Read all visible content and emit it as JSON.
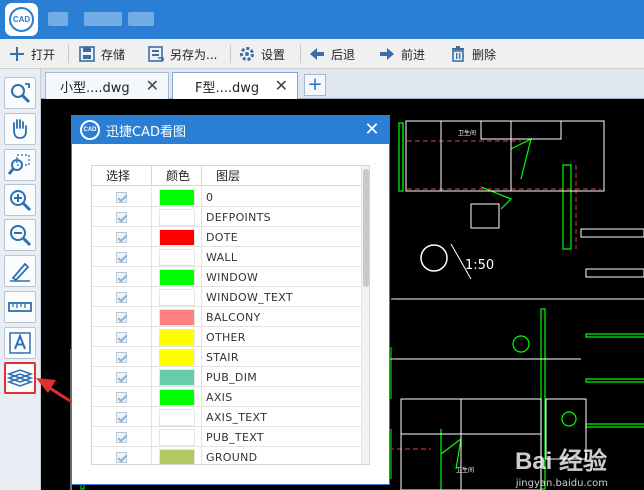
{
  "app": {
    "logo_text": "CAD"
  },
  "toolbar": {
    "open": "打开",
    "save": "存储",
    "save_as": "另存为...",
    "settings": "设置",
    "back": "后退",
    "forward": "前进",
    "delete": "删除"
  },
  "tabs": [
    {
      "label": "小型....dwg",
      "close": "✕"
    },
    {
      "label": "F型....dwg",
      "close": "✕"
    }
  ],
  "tab_add": "+",
  "drawing": {
    "scale_label": "1:50"
  },
  "dialog": {
    "title": "迅捷CAD看图",
    "logo_text": "CAD",
    "close": "✕",
    "columns": {
      "select": "选择",
      "color": "颜色",
      "layer": "图层"
    },
    "layers": [
      {
        "name": "0",
        "color": "#00ff00",
        "checked": true
      },
      {
        "name": "DEFPOINTS",
        "color": "#ffffff",
        "checked": true
      },
      {
        "name": "DOTE",
        "color": "#ff0000",
        "checked": true
      },
      {
        "name": "WALL",
        "color": "#ffffff",
        "checked": true
      },
      {
        "name": "WINDOW",
        "color": "#00ff00",
        "checked": true
      },
      {
        "name": "WINDOW_TEXT",
        "color": "#ffffff",
        "checked": true
      },
      {
        "name": "BALCONY",
        "color": "#ff8080",
        "checked": true
      },
      {
        "name": "OTHER",
        "color": "#ffff00",
        "checked": true
      },
      {
        "name": "STAIR",
        "color": "#ffff00",
        "checked": true
      },
      {
        "name": "PUB_DIM",
        "color": "#66ccaa",
        "checked": true
      },
      {
        "name": "AXIS",
        "color": "#00ff00",
        "checked": true
      },
      {
        "name": "AXIS_TEXT",
        "color": "#ffffff",
        "checked": true
      },
      {
        "name": "PUB_TEXT",
        "color": "#ffffff",
        "checked": true
      },
      {
        "name": "GROUND",
        "color": "#b3c964",
        "checked": true
      }
    ]
  },
  "watermark": {
    "main": "Bai 经验",
    "sub": "jingyan.baidu.com"
  },
  "colors": {
    "titlebar": "#2a7fd4",
    "highlight": "#e03030"
  }
}
